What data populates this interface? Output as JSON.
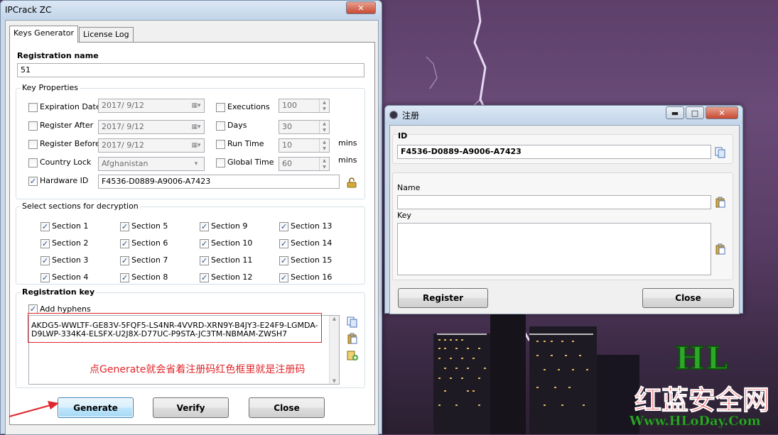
{
  "main_window": {
    "title": "IPCrack ZC",
    "tabs": [
      "Keys Generator",
      "License Log"
    ],
    "registration_name_label": "Registration name",
    "registration_name_value": "51",
    "key_properties": {
      "group_label": "Key Properties",
      "expiration_date": {
        "label": "Expiration Date",
        "checked": false,
        "value": "2017/  9/12"
      },
      "register_after": {
        "label": "Register After",
        "checked": false,
        "value": "2017/  9/12"
      },
      "register_before": {
        "label": "Register Before",
        "checked": false,
        "value": "2017/  9/12"
      },
      "country_lock": {
        "label": "Country Lock",
        "checked": false,
        "value": "Afghanistan"
      },
      "hardware_id": {
        "label": "Hardware ID",
        "checked": true,
        "value": "F4536-D0889-A9006-A7423"
      },
      "executions": {
        "label": "Executions",
        "checked": false,
        "value": "100"
      },
      "days": {
        "label": "Days",
        "checked": false,
        "value": "30"
      },
      "run_time": {
        "label": "Run Time",
        "checked": false,
        "value": "10",
        "unit": "mins"
      },
      "global_time": {
        "label": "Global Time",
        "checked": false,
        "value": "60",
        "unit": "mins"
      }
    },
    "sections_group_label": "Select sections for decryption",
    "sections": [
      "Section 1",
      "Section 5",
      "Section 9",
      "Section 13",
      "Section 2",
      "Section 6",
      "Section 10",
      "Section 14",
      "Section 3",
      "Section 7",
      "Section 11",
      "Section 15",
      "Section 4",
      "Section 8",
      "Section 12",
      "Section 16"
    ],
    "registration_key_label": "Registration key",
    "add_hyphens_label": "Add hyphens",
    "key_line1": "AKDG5-WWLTF-GE83V-5FQF5-LS4NR-4VVRD-XRN9Y-B4JY3-E24F9-LGMDA-",
    "key_line2": "D9LWP-334K4-ELSFX-U2J8X-D77UC-P9STA-JC3TM-NBMAM-ZWSH7",
    "annotation": "点Generate就会省着注册码红色框里就是注册码",
    "buttons": {
      "generate": "Generate",
      "verify": "Verify",
      "close": "Close"
    }
  },
  "reg_window": {
    "title": "注册",
    "id_label": "ID",
    "id_value": "F4536-D0889-A9006-A7423",
    "name_label": "Name",
    "name_value": "",
    "key_label": "Key",
    "key_value": "",
    "buttons": {
      "register": "Register",
      "close": "Close"
    }
  },
  "watermark": {
    "line1": "HL",
    "line2": "红蓝安全网",
    "line3": "Www.HLoDay.Com"
  },
  "colors": {
    "annotation_red": "#e0262b",
    "watermark_green": "#2ea82a"
  }
}
